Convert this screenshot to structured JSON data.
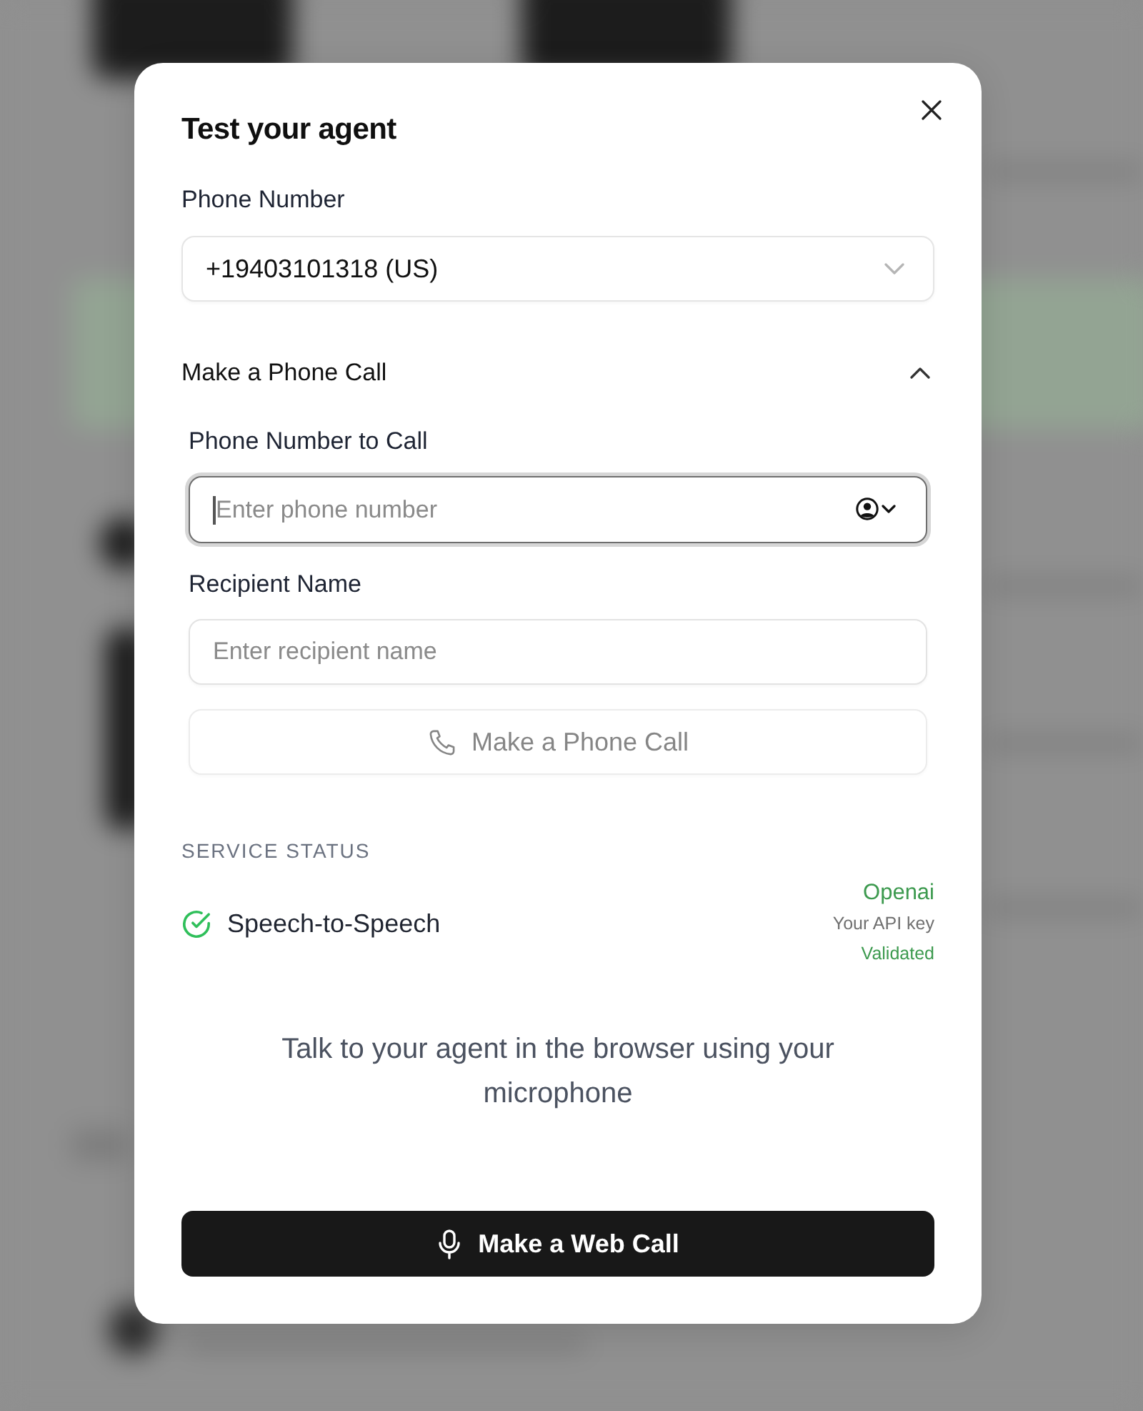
{
  "dialog": {
    "title": "Test your agent"
  },
  "phone_number": {
    "label": "Phone Number",
    "value": "+19403101318 (US)"
  },
  "phone_call": {
    "title": "Make a Phone Call",
    "expanded": true,
    "fields": [
      {
        "kind": "phone",
        "label": "Phone Number to Call",
        "placeholder": "Enter phone number",
        "focused": true
      },
      {
        "kind": "text",
        "label": "Recipient Name",
        "placeholder": "Enter recipient name",
        "focused": false
      }
    ],
    "button": {
      "label": "Make a Phone Call",
      "disabled": true
    }
  },
  "service_status": {
    "heading": "SERVICE STATUS",
    "services": [
      {
        "name": "Speech-to-Speech",
        "validated": true,
        "provider": "Openai",
        "key_note": "Your API key",
        "status": "Validated"
      }
    ]
  },
  "web_call": {
    "description": "Talk to your agent in the browser using your microphone",
    "button": "Make a Web Call"
  }
}
